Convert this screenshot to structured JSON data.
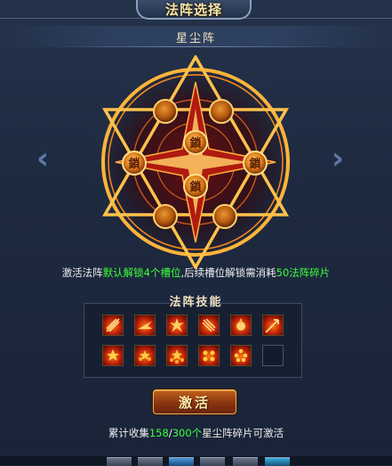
{
  "header": {
    "title": "法阵选择",
    "subtitle": "星尘阵"
  },
  "formation": {
    "lock_label": "鎖",
    "prev_arrow": "‹",
    "next_arrow": "›"
  },
  "info": {
    "part1": "激活法阵",
    "part2": "默认解锁4个槽位",
    "part3": ",后续槽位解锁需消耗",
    "part4": "50法阵碎片"
  },
  "skills": {
    "header": "法阵技能",
    "rows": [
      [
        "flame-slash-icon",
        "fire-dash-icon",
        "fire-burst-icon",
        "claw-strike-icon",
        "fire-orb-icon",
        "flame-arrow-icon"
      ],
      [
        "star-flame-icon",
        "flame-star-2-icon",
        "flame-star-3-icon",
        "flame-star-4-icon",
        "flame-star-5-icon",
        "empty-slot"
      ]
    ]
  },
  "activate_button": {
    "label": "激活"
  },
  "collection": {
    "prefix": "累计收集",
    "current": "158",
    "separator": "/",
    "total": "300个",
    "suffix": "星尘阵碎片可激活"
  },
  "colors": {
    "accent_green": "#3cff3c",
    "gold": "#f3e6b0",
    "button": "#8a3410"
  }
}
